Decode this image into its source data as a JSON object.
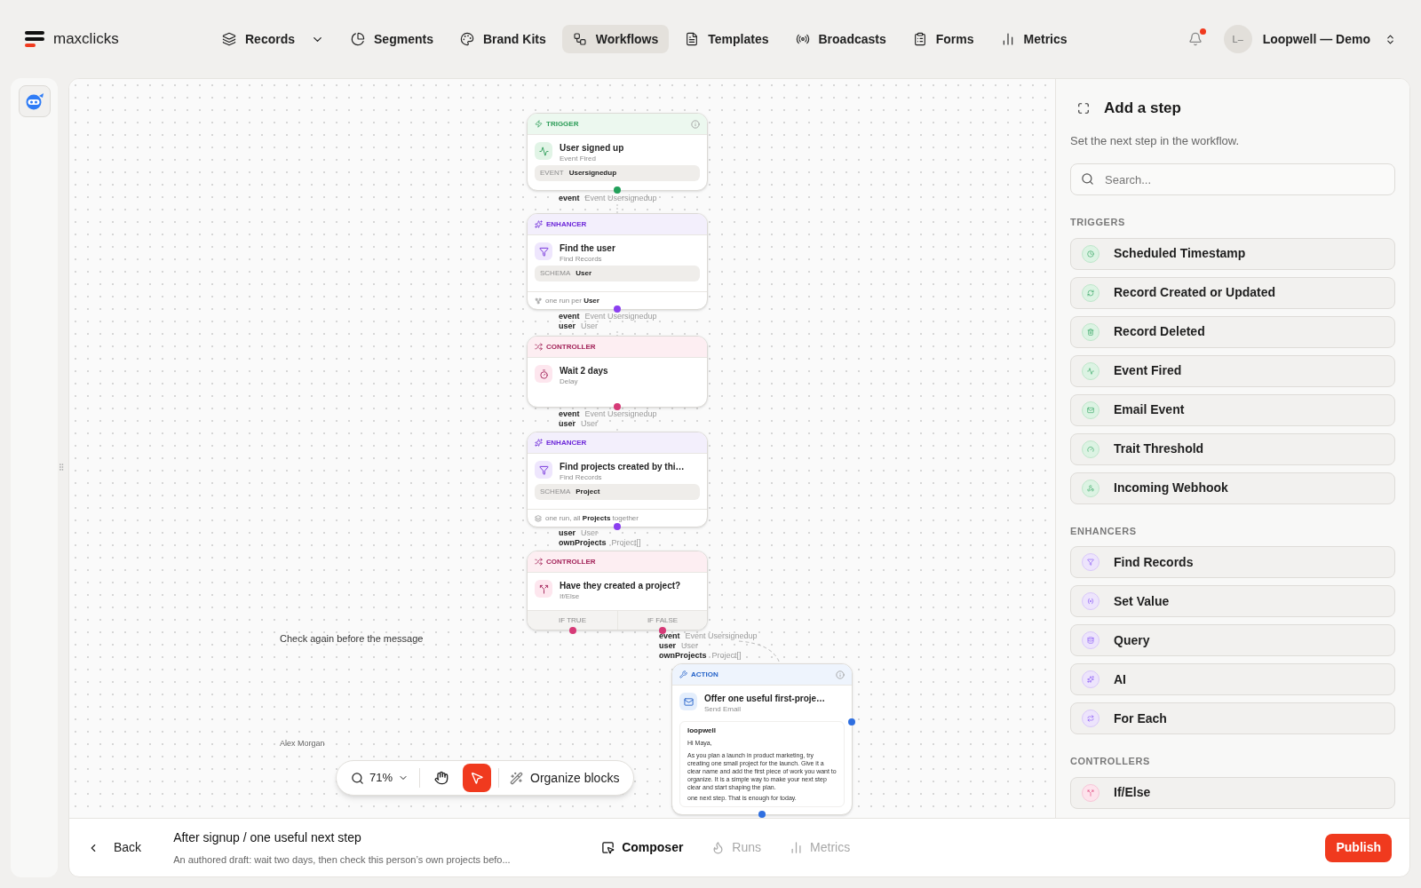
{
  "nav": {
    "logo": "maxclicks",
    "items": [
      {
        "label": "Records",
        "selected": false,
        "has_menu": true
      },
      {
        "label": "Segments",
        "selected": false,
        "has_menu": false
      },
      {
        "label": "Brand Kits",
        "selected": false,
        "has_menu": false
      },
      {
        "label": "Workflows",
        "selected": true,
        "has_menu": false
      },
      {
        "label": "Templates",
        "selected": false,
        "has_menu": false
      },
      {
        "label": "Broadcasts",
        "selected": false,
        "has_menu": false
      },
      {
        "label": "Forms",
        "selected": false,
        "has_menu": false
      },
      {
        "label": "Metrics",
        "selected": false,
        "has_menu": false
      }
    ]
  },
  "notifications": {
    "unread": true
  },
  "account": {
    "initials": "L–",
    "name": "Loopwell — Demo"
  },
  "canvas": {
    "nodes": [
      {
        "kind": "trigger",
        "category": "TRIGGER",
        "info": true,
        "title": "User signed up",
        "subtitle": "Event Fired",
        "field": {
          "label": "EVENT",
          "value": "Usersignedup"
        }
      },
      {
        "kind": "enhancer",
        "category": "ENHANCER",
        "info": false,
        "title": "Find the user",
        "subtitle": "Find Records",
        "field": {
          "label": "SCHEMA",
          "value": "User"
        },
        "footer": {
          "kind": "each",
          "text": "one run per **User**"
        }
      },
      {
        "kind": "controller",
        "category": "CONTROLLER",
        "info": false,
        "title": "Wait 2 days",
        "subtitle": "Delay"
      },
      {
        "kind": "enhancer",
        "category": "ENHANCER",
        "info": false,
        "title": "Find projects created by thi…",
        "subtitle": "Find Records",
        "field": {
          "label": "SCHEMA",
          "value": "Project"
        },
        "footer": {
          "kind": "all",
          "text": "one run, all **Projects** together"
        }
      },
      {
        "kind": "controller",
        "category": "CONTROLLER",
        "info": false,
        "title": "Have they created a project?",
        "subtitle": "If/Else",
        "branches": [
          "IF TRUE",
          "IF FALSE"
        ]
      },
      {
        "kind": "action",
        "category": "ACTION",
        "info": true,
        "title": "Offer one useful first-proje…",
        "subtitle": "Send Email",
        "email": {
          "brand": "loopwell",
          "greeting": "Hi Maya,",
          "body": "As you plan a launch in product marketing, try creating one small project for the launch. Give it a clear name and add the first piece of work you want to organize. It is a simple way to make your next step clear and start shaping the plan.",
          "closing": "one next step. That is enough for today."
        }
      }
    ],
    "outputs": [
      [
        {
          "name": "event",
          "type": "Event Usersignedup"
        }
      ],
      [
        {
          "name": "event",
          "type": "Event Usersignedup"
        },
        {
          "name": "user",
          "type": "User"
        }
      ],
      [
        {
          "name": "event",
          "type": "Event Usersignedup"
        },
        {
          "name": "user",
          "type": "User"
        }
      ],
      [
        {
          "name": "user",
          "type": "User"
        },
        {
          "name": "ownProjects",
          "type": "Project[]"
        }
      ],
      [
        {
          "name": "event",
          "type": "Event Usersignedup"
        },
        {
          "name": "user",
          "type": "User"
        },
        {
          "name": "ownProjects",
          "type": "Project[]"
        }
      ]
    ],
    "notes": [
      {
        "kind": "comment",
        "text": "Check again before the message"
      },
      {
        "kind": "author",
        "text": "Alex Morgan"
      }
    ],
    "toolbar": {
      "zoom": "71%",
      "tools": [
        {
          "kind": "hand",
          "selected": false
        },
        {
          "kind": "pointer",
          "selected": true
        }
      ],
      "organize": "Organize blocks"
    }
  },
  "panel": {
    "title": "Add a step",
    "subtitle": "Set the next step in the workflow.",
    "search": {
      "placeholder": "Search..."
    },
    "sections": [
      {
        "kind": "trigger",
        "title": "TRIGGERS",
        "items": [
          "Scheduled Timestamp",
          "Record Created or Updated",
          "Record Deleted",
          "Event Fired",
          "Email Event",
          "Trait Threshold",
          "Incoming Webhook"
        ]
      },
      {
        "kind": "enhancer",
        "title": "ENHANCERS",
        "items": [
          "Find Records",
          "Set Value",
          "Query",
          "AI",
          "For Each"
        ]
      },
      {
        "kind": "controller",
        "title": "CONTROLLERS",
        "items": [
          "If/Else"
        ]
      }
    ]
  },
  "footer": {
    "back": "Back",
    "title": "After signup / one useful next step",
    "description": "An authored draft: wait two days, then check this person’s own projects befo...",
    "tabs": [
      {
        "label": "Composer",
        "selected": true
      },
      {
        "label": "Runs",
        "selected": false
      },
      {
        "label": "Metrics",
        "selected": false
      }
    ],
    "publish": "Publish"
  }
}
